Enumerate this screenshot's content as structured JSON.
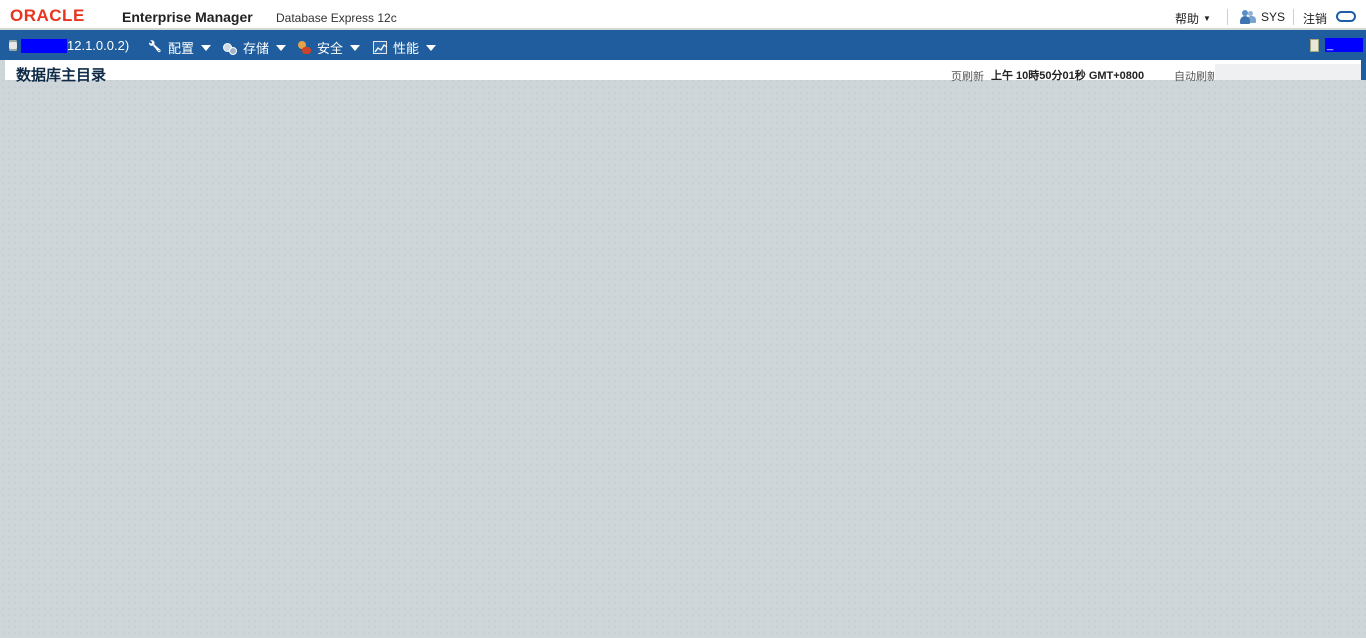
{
  "header": {
    "logo_text": "ORACLE",
    "product_name": "Enterprise Manager",
    "product_subtitle": "Database Express 12c",
    "help_label": "帮助",
    "user_name": "SYS",
    "logout_label": "注销",
    "logo_color": "#e8351f",
    "brand_blue": "#1f5d9e"
  },
  "navbar": {
    "database_version": "12.1.0.0.2)",
    "menus": [
      {
        "label": "配置",
        "icon": "wrench-icon"
      },
      {
        "label": "存储",
        "icon": "storage-icon"
      },
      {
        "label": "安全",
        "icon": "security-icon"
      },
      {
        "label": "性能",
        "icon": "performance-icon"
      }
    ],
    "right_text": "_"
  },
  "main": {
    "page_title": "数据库主目录",
    "refresh_label": "页刷新",
    "refresh_time": "上午 10時50分01秒 GMT+0800",
    "auto_refresh_label": "自动刷新"
  }
}
